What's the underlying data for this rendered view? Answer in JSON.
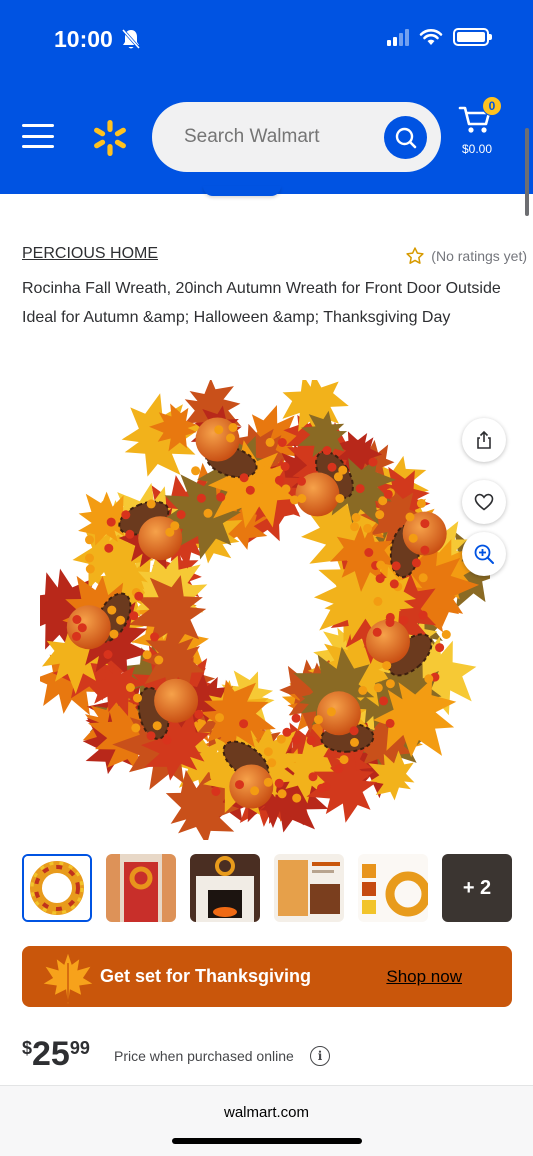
{
  "status_bar": {
    "time": "10:00",
    "icons": [
      "bell-off-icon",
      "signal-icon",
      "wifi-icon",
      "battery-icon"
    ]
  },
  "header": {
    "brand_color": "#0053e2",
    "accent_color": "#ffc220",
    "search_placeholder": "Search Walmart",
    "cart_count": "0",
    "cart_total": "$0.00"
  },
  "product": {
    "brand": "PERCIOUS HOME",
    "rating_text": "(No ratings yet)",
    "title": "Rocinha Fall Wreath, 20inch Autumn Wreath for Front Door Outside Ideal for Autumn &amp; Halloween &amp; Thanksgiving Day",
    "thumbnails_more": "+ 2"
  },
  "promo": {
    "text": "Get set for Thanksgiving",
    "link": "Shop now",
    "color": "#c9560b"
  },
  "price": {
    "symbol": "$",
    "dollars": "25",
    "cents": "99",
    "note": "Price when purchased online",
    "info": "i"
  },
  "browser": {
    "url": "walmart.com"
  }
}
